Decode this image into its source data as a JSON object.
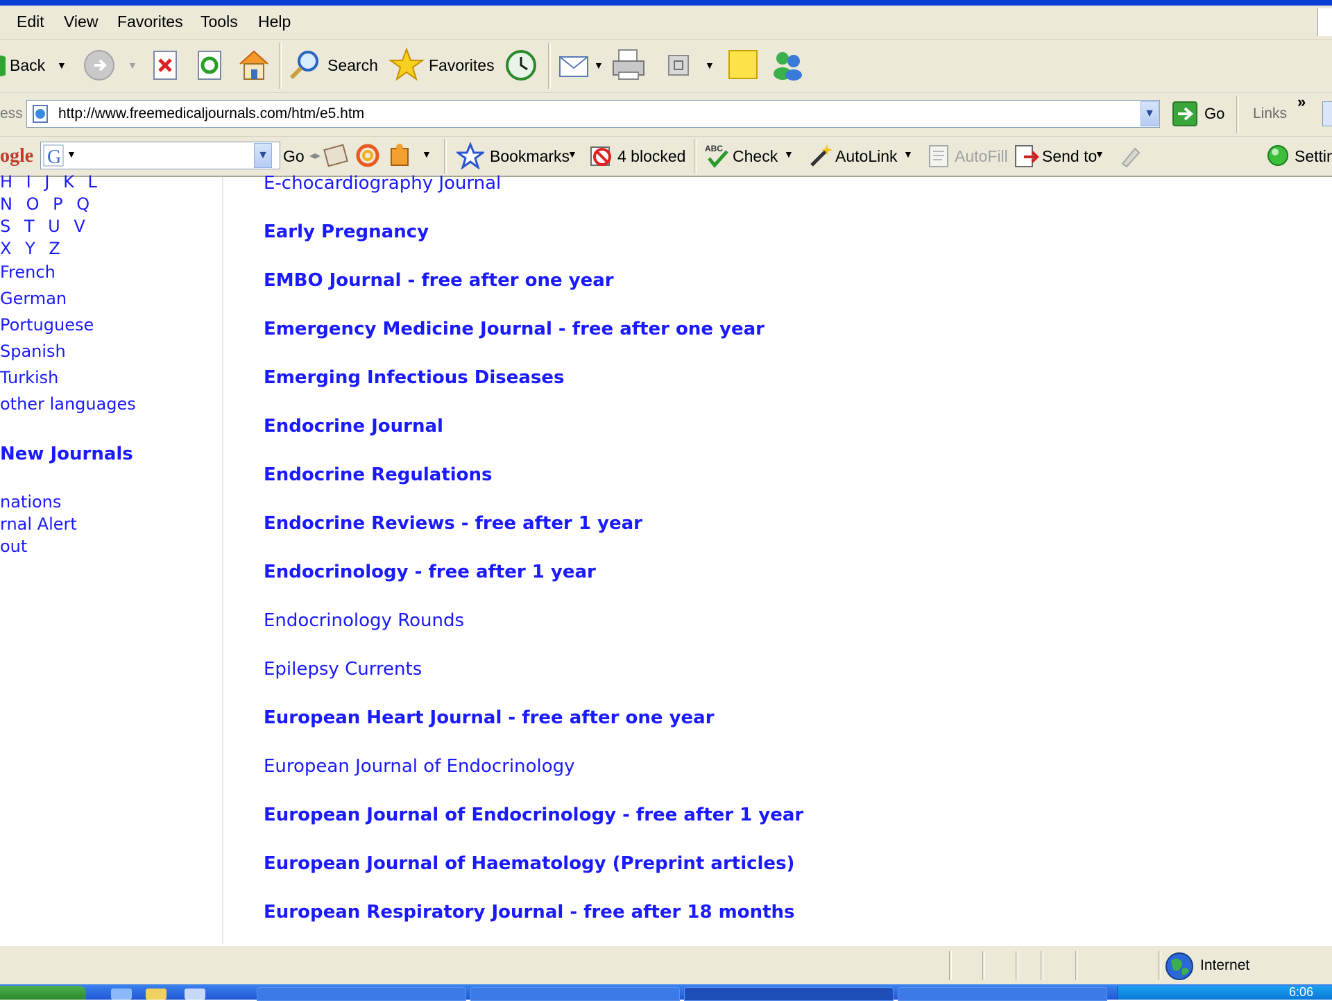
{
  "menu": {
    "items": [
      "Edit",
      "View",
      "Favorites",
      "Tools",
      "Help"
    ]
  },
  "toolbar": {
    "back_label": "Back",
    "search_label": "Search",
    "favorites_label": "Favorites"
  },
  "address": {
    "label": "ess",
    "url": "http://www.freemedicaljournals.com/htm/e5.htm",
    "go_label": "Go",
    "links_label": "Links"
  },
  "googlebar": {
    "logo_text": "ogle",
    "go_label": "Go",
    "bookmarks_label": "Bookmarks",
    "blocked_label": "4 blocked",
    "check_label": "Check",
    "autolink_label": "AutoLink",
    "autofill_label": "AutoFill",
    "sendto_label": "Send to",
    "settings_label": "Settin"
  },
  "sidebar": {
    "letter_rows": [
      "H  I  J  K  L",
      "N  O  P  Q",
      "S  T  U  V",
      "X  Y  Z"
    ],
    "languages": [
      "French",
      "German",
      "Portuguese",
      "Spanish",
      "Turkish",
      "other languages"
    ],
    "new_journals": "New Journals",
    "bottom_links": [
      "nations",
      "rnal Alert",
      "out"
    ]
  },
  "journals": [
    {
      "title": "E-chocardiography Journal",
      "bold": false
    },
    {
      "title": "Early Pregnancy",
      "bold": true
    },
    {
      "title": "EMBO Journal - free after one year",
      "bold": true
    },
    {
      "title": "Emergency Medicine Journal - free after one year",
      "bold": true
    },
    {
      "title": "Emerging Infectious Diseases",
      "bold": true
    },
    {
      "title": "Endocrine Journal",
      "bold": true
    },
    {
      "title": "Endocrine Regulations",
      "bold": true
    },
    {
      "title": "Endocrine Reviews - free after 1 year",
      "bold": true
    },
    {
      "title": "Endocrinology - free after 1 year",
      "bold": true
    },
    {
      "title": "Endocrinology Rounds",
      "bold": false
    },
    {
      "title": "Epilepsy Currents",
      "bold": false
    },
    {
      "title": "European Heart Journal - free after one year",
      "bold": true
    },
    {
      "title": "European Journal of Endocrinology",
      "bold": false
    },
    {
      "title": "European Journal of Endocrinology - free after 1 year",
      "bold": true
    },
    {
      "title": "European Journal of Haematology (Preprint articles)",
      "bold": true
    },
    {
      "title": "European Respiratory Journal - free after 18 months",
      "bold": true
    }
  ],
  "status": {
    "zone_label": "Internet",
    "clock": "6:06"
  },
  "colors": {
    "link": "#1a1aff",
    "chrome": "#ece9d8",
    "title_blue": "#0a3fd6"
  }
}
